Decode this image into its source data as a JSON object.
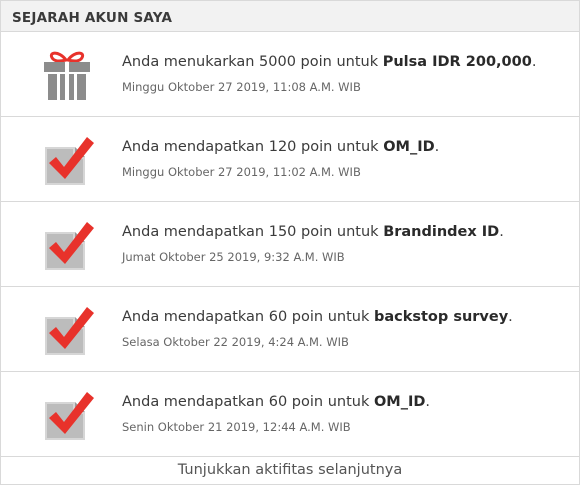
{
  "section_title": "SEJARAH AKUN SAYA",
  "items": [
    {
      "icon": "gift-icon",
      "prefix": "Anda menukarkan 5000 poin untuk ",
      "target": "Pulsa IDR 200,000",
      "suffix": ".",
      "date": "Minggu Oktober 27 2019, 11:08 A.M. WIB"
    },
    {
      "icon": "checked-document-icon",
      "prefix": "Anda mendapatkan 120 poin untuk ",
      "target": "OM_ID",
      "suffix": ".",
      "date": "Minggu Oktober 27 2019, 11:02 A.M. WIB"
    },
    {
      "icon": "checked-document-icon",
      "prefix": "Anda mendapatkan 150 poin untuk ",
      "target": "Brandindex ID",
      "suffix": ".",
      "date": "Jumat Oktober 25 2019, 9:32 A.M. WIB"
    },
    {
      "icon": "checked-document-icon",
      "prefix": "Anda mendapatkan 60 poin untuk ",
      "target": "backstop survey",
      "suffix": ".",
      "date": "Selasa Oktober 22 2019, 4:24 A.M. WIB"
    },
    {
      "icon": "checked-document-icon",
      "prefix": "Anda mendapatkan 60 poin untuk ",
      "target": "OM_ID",
      "suffix": ".",
      "date": "Senin Oktober 21 2019, 12:44 A.M. WIB"
    }
  ],
  "more_link": "Tunjukkan aktifitas selanjutnya",
  "colors": {
    "check_red": "#e8322b",
    "icon_gray": "#8c8c8c",
    "header_bg": "#f2f2f2",
    "border": "#d9d9d9"
  }
}
